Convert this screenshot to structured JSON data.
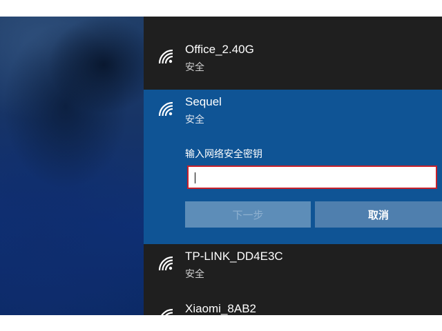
{
  "networks": [
    {
      "ssid": "Office_2.40G",
      "status": "安全",
      "icon": "wifi-icon"
    },
    {
      "ssid": "Sequel",
      "status": "安全",
      "icon": "wifi-icon",
      "expanded": true,
      "key_prompt": "输入网络安全密钥",
      "key_value": "",
      "next_label": "下一步",
      "cancel_label": "取消"
    },
    {
      "ssid": "TP-LINK_DD4E3C",
      "status": "安全",
      "icon": "wifi-icon"
    },
    {
      "ssid": "Xiaomi_8AB2",
      "icon": "wifi-icon"
    }
  ],
  "colors": {
    "panel_bg": "#1f1f1f",
    "selected_bg": "#0f5495",
    "input_border": "#c8202a",
    "button_bg": "#4f7fae"
  }
}
